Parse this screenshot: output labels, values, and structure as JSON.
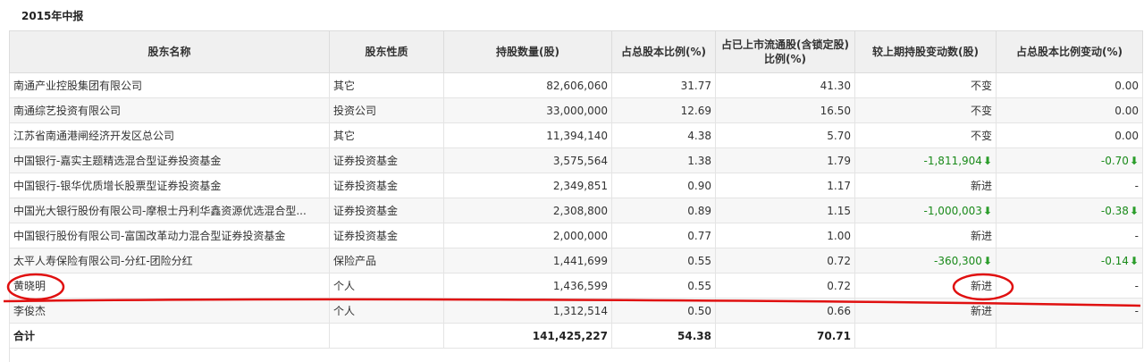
{
  "report": {
    "title": "2015年中报"
  },
  "table": {
    "headers": {
      "holder_name": "股东名称",
      "holder_type": "股东性质",
      "shares": "持股数量(股)",
      "pct_total": "占总股本比例(%)",
      "pct_float": "占已上市流通股(含锁定股)比例(%)",
      "change_shares": "较上期持股变动数(股)",
      "change_pct": "占总股本比例变动(%)"
    },
    "rows": [
      {
        "name": "南通产业控股集团有限公司",
        "type": "其它",
        "shares": "82,606,060",
        "pct_total": "31.77",
        "pct_float": "41.30",
        "change": "不变",
        "change_pct": "0.00",
        "change_down": false,
        "pct_down": false
      },
      {
        "name": "南通综艺投资有限公司",
        "type": "投资公司",
        "shares": "33,000,000",
        "pct_total": "12.69",
        "pct_float": "16.50",
        "change": "不变",
        "change_pct": "0.00",
        "change_down": false,
        "pct_down": false
      },
      {
        "name": "江苏省南通港闸经济开发区总公司",
        "type": "其它",
        "shares": "11,394,140",
        "pct_total": "4.38",
        "pct_float": "5.70",
        "change": "不变",
        "change_pct": "0.00",
        "change_down": false,
        "pct_down": false
      },
      {
        "name": "中国银行-嘉实主题精选混合型证券投资基金",
        "type": "证券投资基金",
        "shares": "3,575,564",
        "pct_total": "1.38",
        "pct_float": "1.79",
        "change": "-1,811,904",
        "change_pct": "-0.70",
        "change_down": true,
        "pct_down": true
      },
      {
        "name": "中国银行-银华优质增长股票型证券投资基金",
        "type": "证券投资基金",
        "shares": "2,349,851",
        "pct_total": "0.90",
        "pct_float": "1.17",
        "change": "新进",
        "change_pct": "-",
        "change_down": false,
        "pct_down": false
      },
      {
        "name": "中国光大银行股份有限公司-摩根士丹利华鑫资源优选混合型...",
        "type": "证券投资基金",
        "shares": "2,308,800",
        "pct_total": "0.89",
        "pct_float": "1.15",
        "change": "-1,000,003",
        "change_pct": "-0.38",
        "change_down": true,
        "pct_down": true
      },
      {
        "name": "中国银行股份有限公司-富国改革动力混合型证券投资基金",
        "type": "证券投资基金",
        "shares": "2,000,000",
        "pct_total": "0.77",
        "pct_float": "1.00",
        "change": "新进",
        "change_pct": "-",
        "change_down": false,
        "pct_down": false
      },
      {
        "name": "太平人寿保险有限公司-分红-团险分红",
        "type": "保险产品",
        "shares": "1,441,699",
        "pct_total": "0.55",
        "pct_float": "0.72",
        "change": "-360,300",
        "change_pct": "-0.14",
        "change_down": true,
        "pct_down": true
      },
      {
        "name": "黄晓明",
        "type": "个人",
        "shares": "1,436,599",
        "pct_total": "0.55",
        "pct_float": "0.72",
        "change": "新进",
        "change_pct": "-",
        "change_down": false,
        "pct_down": false
      },
      {
        "name": "李俊杰",
        "type": "个人",
        "shares": "1,312,514",
        "pct_total": "0.50",
        "pct_float": "0.66",
        "change": "新进",
        "change_pct": "-",
        "change_down": false,
        "pct_down": false
      }
    ],
    "total": {
      "label": "合计",
      "shares": "141,425,227",
      "pct_total": "54.38",
      "pct_float": "70.71"
    }
  },
  "colors": {
    "header_bg": "#f0f0f0",
    "alt_row_bg": "#f7f7f7",
    "decrease_green": "#1a8a1a",
    "annotation_red": "#e01010"
  }
}
